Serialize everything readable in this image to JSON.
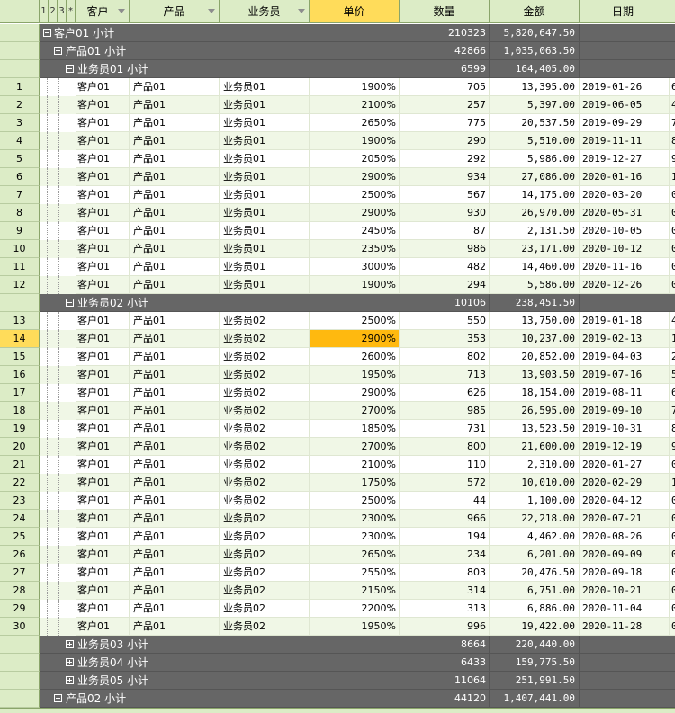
{
  "header": {
    "levels": [
      "1",
      "2",
      "3",
      "*"
    ],
    "columns": {
      "customer": "客户",
      "product": "产品",
      "salesperson": "业务员",
      "unit_price": "单价",
      "quantity": "数量",
      "amount": "金额",
      "date": "日期"
    }
  },
  "groups": {
    "g_customer01": {
      "label": "客户01 小计",
      "qty": "210323",
      "amount": "5,820,647.50"
    },
    "g_product01": {
      "label": "产品01 小计",
      "qty": "42866",
      "amount": "1,035,063.50"
    },
    "g_rep01": {
      "label": "业务员01 小计",
      "qty": "6599",
      "amount": "164,405.00"
    },
    "g_rep02": {
      "label": "业务员02 小计",
      "qty": "10106",
      "amount": "238,451.50"
    },
    "g_rep03": {
      "label": "业务员03 小计",
      "qty": "8664",
      "amount": "220,440.00"
    },
    "g_rep04": {
      "label": "业务员04 小计",
      "qty": "6433",
      "amount": "159,775.50"
    },
    "g_rep05": {
      "label": "业务员05 小计",
      "qty": "11064",
      "amount": "251,991.50"
    },
    "g_product02": {
      "label": "产品02 小计",
      "qty": "44120",
      "amount": "1,407,441.00"
    }
  },
  "rows_block1": [
    {
      "n": "1",
      "cust": "客户01",
      "prod": "产品01",
      "rep": "业务员01",
      "price": "1900%",
      "qty": "705",
      "amt": "13,395.00",
      "date": "2019-01-26",
      "x": "6"
    },
    {
      "n": "2",
      "cust": "客户01",
      "prod": "产品01",
      "rep": "业务员01",
      "price": "2100%",
      "qty": "257",
      "amt": "5,397.00",
      "date": "2019-06-05",
      "x": "4"
    },
    {
      "n": "3",
      "cust": "客户01",
      "prod": "产品01",
      "rep": "业务员01",
      "price": "2650%",
      "qty": "775",
      "amt": "20,537.50",
      "date": "2019-09-29",
      "x": "7"
    },
    {
      "n": "4",
      "cust": "客户01",
      "prod": "产品01",
      "rep": "业务员01",
      "price": "1900%",
      "qty": "290",
      "amt": "5,510.00",
      "date": "2019-11-11",
      "x": "8"
    },
    {
      "n": "5",
      "cust": "客户01",
      "prod": "产品01",
      "rep": "业务员01",
      "price": "2050%",
      "qty": "292",
      "amt": "5,986.00",
      "date": "2019-12-27",
      "x": "9"
    },
    {
      "n": "6",
      "cust": "客户01",
      "prod": "产品01",
      "rep": "业务员01",
      "price": "2900%",
      "qty": "934",
      "amt": "27,086.00",
      "date": "2020-01-16",
      "x": "1"
    },
    {
      "n": "7",
      "cust": "客户01",
      "prod": "产品01",
      "rep": "业务员01",
      "price": "2500%",
      "qty": "567",
      "amt": "14,175.00",
      "date": "2020-03-20",
      "x": "0"
    },
    {
      "n": "8",
      "cust": "客户01",
      "prod": "产品01",
      "rep": "业务员01",
      "price": "2900%",
      "qty": "930",
      "amt": "26,970.00",
      "date": "2020-05-31",
      "x": "0"
    },
    {
      "n": "9",
      "cust": "客户01",
      "prod": "产品01",
      "rep": "业务员01",
      "price": "2450%",
      "qty": "87",
      "amt": "2,131.50",
      "date": "2020-10-05",
      "x": "0"
    },
    {
      "n": "10",
      "cust": "客户01",
      "prod": "产品01",
      "rep": "业务员01",
      "price": "2350%",
      "qty": "986",
      "amt": "23,171.00",
      "date": "2020-10-12",
      "x": "0"
    },
    {
      "n": "11",
      "cust": "客户01",
      "prod": "产品01",
      "rep": "业务员01",
      "price": "3000%",
      "qty": "482",
      "amt": "14,460.00",
      "date": "2020-11-16",
      "x": "0"
    },
    {
      "n": "12",
      "cust": "客户01",
      "prod": "产品01",
      "rep": "业务员01",
      "price": "1900%",
      "qty": "294",
      "amt": "5,586.00",
      "date": "2020-12-26",
      "x": "0"
    }
  ],
  "rows_block2": [
    {
      "n": "13",
      "cust": "客户01",
      "prod": "产品01",
      "rep": "业务员02",
      "price": "2500%",
      "qty": "550",
      "amt": "13,750.00",
      "date": "2019-01-18",
      "x": "4"
    },
    {
      "n": "14",
      "cust": "客户01",
      "prod": "产品01",
      "rep": "业务员02",
      "price": "2900%",
      "qty": "353",
      "amt": "10,237.00",
      "date": "2019-02-13",
      "x": "1"
    },
    {
      "n": "15",
      "cust": "客户01",
      "prod": "产品01",
      "rep": "业务员02",
      "price": "2600%",
      "qty": "802",
      "amt": "20,852.00",
      "date": "2019-04-03",
      "x": "2"
    },
    {
      "n": "16",
      "cust": "客户01",
      "prod": "产品01",
      "rep": "业务员02",
      "price": "1950%",
      "qty": "713",
      "amt": "13,903.50",
      "date": "2019-07-16",
      "x": "5"
    },
    {
      "n": "17",
      "cust": "客户01",
      "prod": "产品01",
      "rep": "业务员02",
      "price": "2900%",
      "qty": "626",
      "amt": "18,154.00",
      "date": "2019-08-11",
      "x": "6"
    },
    {
      "n": "18",
      "cust": "客户01",
      "prod": "产品01",
      "rep": "业务员02",
      "price": "2700%",
      "qty": "985",
      "amt": "26,595.00",
      "date": "2019-09-10",
      "x": "7"
    },
    {
      "n": "19",
      "cust": "客户01",
      "prod": "产品01",
      "rep": "业务员02",
      "price": "1850%",
      "qty": "731",
      "amt": "13,523.50",
      "date": "2019-10-31",
      "x": "8"
    },
    {
      "n": "20",
      "cust": "客户01",
      "prod": "产品01",
      "rep": "业务员02",
      "price": "2700%",
      "qty": "800",
      "amt": "21,600.00",
      "date": "2019-12-19",
      "x": "9"
    },
    {
      "n": "21",
      "cust": "客户01",
      "prod": "产品01",
      "rep": "业务员02",
      "price": "2100%",
      "qty": "110",
      "amt": "2,310.00",
      "date": "2020-01-27",
      "x": "0"
    },
    {
      "n": "22",
      "cust": "客户01",
      "prod": "产品01",
      "rep": "业务员02",
      "price": "1750%",
      "qty": "572",
      "amt": "10,010.00",
      "date": "2020-02-29",
      "x": "1"
    },
    {
      "n": "23",
      "cust": "客户01",
      "prod": "产品01",
      "rep": "业务员02",
      "price": "2500%",
      "qty": "44",
      "amt": "1,100.00",
      "date": "2020-04-12",
      "x": "0"
    },
    {
      "n": "24",
      "cust": "客户01",
      "prod": "产品01",
      "rep": "业务员02",
      "price": "2300%",
      "qty": "966",
      "amt": "22,218.00",
      "date": "2020-07-21",
      "x": "0"
    },
    {
      "n": "25",
      "cust": "客户01",
      "prod": "产品01",
      "rep": "业务员02",
      "price": "2300%",
      "qty": "194",
      "amt": "4,462.00",
      "date": "2020-08-26",
      "x": "0"
    },
    {
      "n": "26",
      "cust": "客户01",
      "prod": "产品01",
      "rep": "业务员02",
      "price": "2650%",
      "qty": "234",
      "amt": "6,201.00",
      "date": "2020-09-09",
      "x": "0"
    },
    {
      "n": "27",
      "cust": "客户01",
      "prod": "产品01",
      "rep": "业务员02",
      "price": "2550%",
      "qty": "803",
      "amt": "20,476.50",
      "date": "2020-09-18",
      "x": "0"
    },
    {
      "n": "28",
      "cust": "客户01",
      "prod": "产品01",
      "rep": "业务员02",
      "price": "2150%",
      "qty": "314",
      "amt": "6,751.00",
      "date": "2020-10-21",
      "x": "0"
    },
    {
      "n": "29",
      "cust": "客户01",
      "prod": "产品01",
      "rep": "业务员02",
      "price": "2200%",
      "qty": "313",
      "amt": "6,886.00",
      "date": "2020-11-04",
      "x": "0"
    },
    {
      "n": "30",
      "cust": "客户01",
      "prod": "产品01",
      "rep": "业务员02",
      "price": "1950%",
      "qty": "996",
      "amt": "19,422.00",
      "date": "2020-11-28",
      "x": "0"
    }
  ],
  "selection": {
    "row": "14",
    "column": "unit_price"
  },
  "colors": {
    "header_bg": "#dcecc6",
    "group_bg": "#666666",
    "alt_row": "#f0f7e6",
    "selected_header": "#ffdc5a",
    "selected_cell": "#ffb90f"
  }
}
